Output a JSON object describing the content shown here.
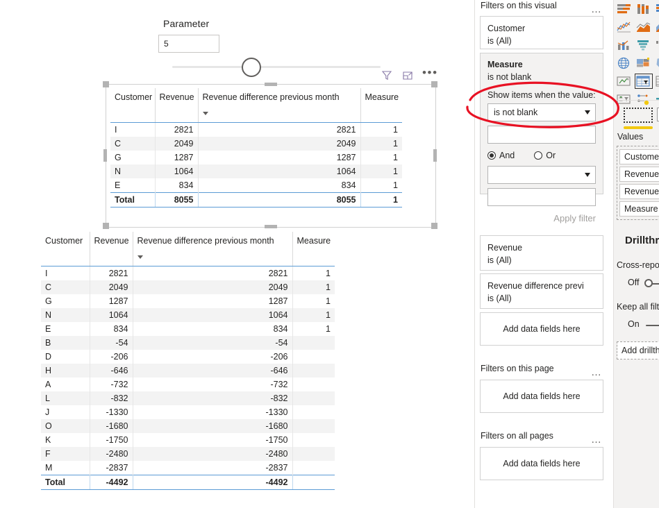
{
  "canvas": {
    "parameter": {
      "label": "Parameter",
      "value": "5"
    },
    "visual_toolbar": {
      "filter_icon": "filter-icon",
      "focus_icon": "focus-mode-icon",
      "more_icon": "more-options-icon",
      "more_glyph": "•••"
    },
    "table1": {
      "columns": [
        "Customer",
        "Revenue",
        "Revenue difference previous month",
        "Measure"
      ],
      "sorted_column_index": 2,
      "rows": [
        [
          "I",
          "2821",
          "2821",
          "1"
        ],
        [
          "C",
          "2049",
          "2049",
          "1"
        ],
        [
          "G",
          "1287",
          "1287",
          "1"
        ],
        [
          "N",
          "1064",
          "1064",
          "1"
        ],
        [
          "E",
          "834",
          "834",
          "1"
        ]
      ],
      "total": [
        "Total",
        "8055",
        "8055",
        "1"
      ]
    },
    "table2": {
      "columns": [
        "Customer",
        "Revenue",
        "Revenue difference previous month",
        "Measure"
      ],
      "sorted_column_index": 2,
      "rows": [
        [
          "I",
          "2821",
          "2821",
          "1"
        ],
        [
          "C",
          "2049",
          "2049",
          "1"
        ],
        [
          "G",
          "1287",
          "1287",
          "1"
        ],
        [
          "N",
          "1064",
          "1064",
          "1"
        ],
        [
          "E",
          "834",
          "834",
          "1"
        ],
        [
          "B",
          "-54",
          "-54",
          ""
        ],
        [
          "D",
          "-206",
          "-206",
          ""
        ],
        [
          "H",
          "-646",
          "-646",
          ""
        ],
        [
          "A",
          "-732",
          "-732",
          ""
        ],
        [
          "L",
          "-832",
          "-832",
          ""
        ],
        [
          "J",
          "-1330",
          "-1330",
          ""
        ],
        [
          "O",
          "-1680",
          "-1680",
          ""
        ],
        [
          "K",
          "-1750",
          "-1750",
          ""
        ],
        [
          "F",
          "-2480",
          "-2480",
          ""
        ],
        [
          "M",
          "-2837",
          "-2837",
          ""
        ]
      ],
      "total": [
        "Total",
        "-4492",
        "-4492",
        ""
      ]
    }
  },
  "filters_pane": {
    "visual_section": {
      "title": "Filters on this visual",
      "ellipsis": "…"
    },
    "page_section": {
      "title": "Filters on this page",
      "ellipsis": "…",
      "add_field_placeholder": "Add data fields here"
    },
    "all_pages_section": {
      "title": "Filters on all pages",
      "ellipsis": "…",
      "add_field_placeholder": "Add data fields here"
    },
    "cards": {
      "customer": {
        "name": "Customer",
        "value": "is (All)"
      },
      "measure": {
        "name": "Measure",
        "value": "is not blank",
        "sublabel": "Show items when the value:",
        "condition_selected": "is not blank",
        "condition_value": "",
        "and_label": "And",
        "or_label": "Or",
        "condition2_selected": "",
        "condition2_value": "",
        "apply_label": "Apply filter"
      },
      "revenue": {
        "name": "Revenue",
        "value": "is (All)"
      },
      "revenue_diff": {
        "name": "Revenue difference previ",
        "value": "is (All)"
      },
      "add_field_placeholder": "Add data fields here"
    }
  },
  "visualizations_pane": {
    "icons": [
      "stacked-bar-chart-icon",
      "stacked-column-chart-icon",
      "clustered-bar-chart-icon",
      "line-chart-icon",
      "area-chart-icon",
      "stacked-area-chart-icon",
      "line-and-column-chart-icon",
      "ribbon-chart-icon",
      "waterfall-chart-icon",
      "map-icon",
      "treemap-icon",
      "filled-map-icon",
      "card-icon",
      "table-icon",
      "matrix-icon",
      "slicer-icon",
      "key-influencers-icon",
      "decomposition-tree-icon"
    ],
    "selected_icon_index": 13,
    "field_well": {
      "visual_type_icon": "table-visual-icon",
      "format_icon": "format-pane-icon",
      "label": "Values",
      "pills": [
        "Customer",
        "Revenue",
        "Revenue d",
        "Measure"
      ]
    },
    "drillthrough": {
      "title": "Drillthro",
      "cross_report_label": "Cross-repo",
      "cross_report_state": "Off",
      "keep_filters_label": "Keep all filt",
      "keep_filters_state": "On",
      "add_field_placeholder": "Add drillth"
    }
  },
  "annotation": {
    "type": "red-ellipse",
    "color": "#e81123",
    "target": "Show items when the value: is not blank"
  }
}
